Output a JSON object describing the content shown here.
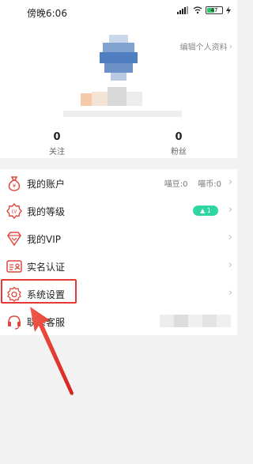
{
  "status": {
    "time": "傍晚6:06",
    "battery": "47"
  },
  "profile": {
    "edit_label": "编辑个人资料",
    "follow_count": "0",
    "follow_label": "关注",
    "fans_count": "0",
    "fans_label": "粉丝"
  },
  "menu": {
    "items": [
      {
        "label": "我的账户",
        "icon": "moneybag-icon",
        "right": "喵豆:0    喵币:0"
      },
      {
        "label": "我的等级",
        "icon": "level-icon",
        "badge": "▲ 1"
      },
      {
        "label": "我的VIP",
        "icon": "diamond-icon"
      },
      {
        "label": "实名认证",
        "icon": "id-card-icon"
      },
      {
        "label": "系统设置",
        "icon": "gear-icon"
      },
      {
        "label": "联系客服",
        "icon": "headset-icon"
      }
    ]
  },
  "colors": {
    "accent_red": "#e53935",
    "badge_green": "#2fd6a1",
    "icon_red": "#e0473f"
  }
}
